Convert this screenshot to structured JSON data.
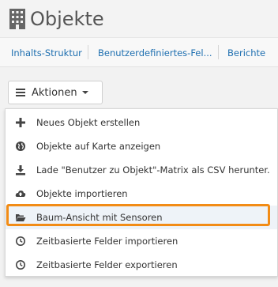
{
  "header": {
    "title": "Objekte",
    "title_icon": "building-icon"
  },
  "tabs": [
    {
      "label": "Inhalts-Struktur"
    },
    {
      "label": "Benutzerdefiniertes-Fel..."
    },
    {
      "label": "Berichte"
    }
  ],
  "actions": {
    "label": "Aktionen"
  },
  "menu": {
    "items": [
      {
        "label": "Neues Objekt erstellen",
        "icon": "plus-icon"
      },
      {
        "label": "Objekte auf Karte anzeigen",
        "icon": "globe-icon"
      },
      {
        "label": "Lade \"Benutzer zu Objekt\"-Matrix als CSV herunter.",
        "icon": "download-icon"
      },
      {
        "label": "Objekte importieren",
        "icon": "cloud-upload-icon"
      },
      {
        "label": "Baum-Ansicht mit Sensoren",
        "icon": "folder-open-icon",
        "highlighted": true
      },
      {
        "label": "Zeitbasierte Felder importieren",
        "icon": "clock-icon"
      },
      {
        "label": "Zeitbasierte Felder exportieren",
        "icon": "clock-icon"
      }
    ]
  },
  "colors": {
    "link": "#1e6fb0",
    "highlight": "#f28c16"
  }
}
